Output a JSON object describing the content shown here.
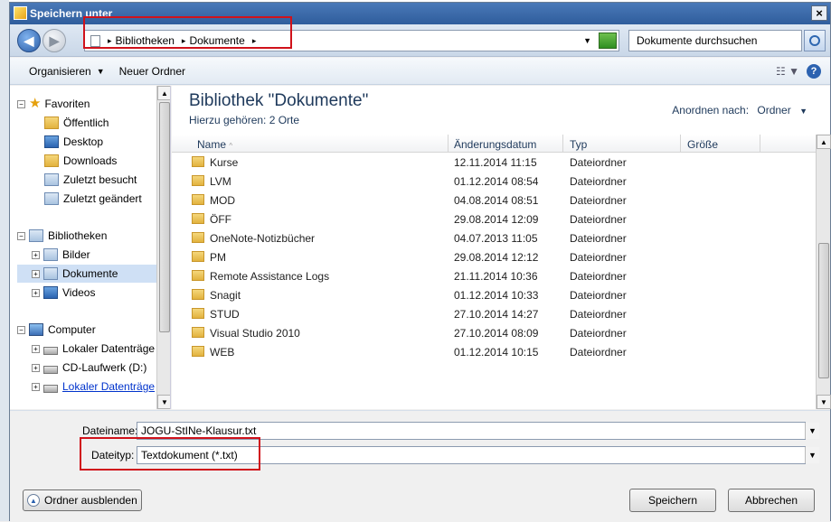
{
  "window": {
    "title": "Speichern unter",
    "close_glyph": "×"
  },
  "nav": {
    "breadcrumbs": [
      "Bibliotheken",
      "Dokumente"
    ],
    "search_placeholder": "Dokumente durchsuchen"
  },
  "toolbar": {
    "organize": "Organisieren",
    "new_folder": "Neuer Ordner",
    "help": "?"
  },
  "tree": {
    "favorites": "Favoriten",
    "fav_items": [
      "Öffentlich",
      "Desktop",
      "Downloads",
      "Zuletzt besucht",
      "Zuletzt geändert"
    ],
    "libraries": "Bibliotheken",
    "lib_items": [
      "Bilder",
      "Dokumente",
      "Videos"
    ],
    "computer": "Computer",
    "comp_items": [
      "Lokaler Datenträge",
      "CD-Laufwerk (D:)",
      "Lokaler Datenträge"
    ]
  },
  "content": {
    "title": "Bibliothek \"Dokumente\"",
    "subtitle": "Hierzu gehören:  2 Orte",
    "arrange_label": "Anordnen nach:",
    "arrange_value": "Ordner",
    "columns": {
      "name": "Name",
      "date": "Änderungsdatum",
      "type": "Typ",
      "size": "Größe"
    },
    "rows": [
      {
        "name": "Kurse",
        "date": "12.11.2014 11:15",
        "type": "Dateiordner"
      },
      {
        "name": "LVM",
        "date": "01.12.2014 08:54",
        "type": "Dateiordner"
      },
      {
        "name": "MOD",
        "date": "04.08.2014 08:51",
        "type": "Dateiordner"
      },
      {
        "name": "ÖFF",
        "date": "29.08.2014 12:09",
        "type": "Dateiordner"
      },
      {
        "name": "OneNote-Notizbücher",
        "date": "04.07.2013 11:05",
        "type": "Dateiordner"
      },
      {
        "name": "PM",
        "date": "29.08.2014 12:12",
        "type": "Dateiordner"
      },
      {
        "name": "Remote Assistance Logs",
        "date": "21.11.2014 10:36",
        "type": "Dateiordner"
      },
      {
        "name": "Snagit",
        "date": "01.12.2014 10:33",
        "type": "Dateiordner"
      },
      {
        "name": "STUD",
        "date": "27.10.2014 14:27",
        "type": "Dateiordner"
      },
      {
        "name": "Visual Studio 2010",
        "date": "27.10.2014 08:09",
        "type": "Dateiordner"
      },
      {
        "name": "WEB",
        "date": "01.12.2014 10:15",
        "type": "Dateiordner"
      }
    ]
  },
  "bottom": {
    "filename_label": "Dateiname:",
    "filename_value": "JOGU-StINe-Klausur.txt",
    "filetype_label": "Dateityp:",
    "filetype_value": "Textdokument (*.txt)",
    "hide_folders": "Ordner ausblenden",
    "save": "Speichern",
    "cancel": "Abbrechen"
  },
  "colors": {
    "title_blue": "#2f5d9c",
    "highlight_red": "#d0121b",
    "link_blue": "#0033cc"
  }
}
